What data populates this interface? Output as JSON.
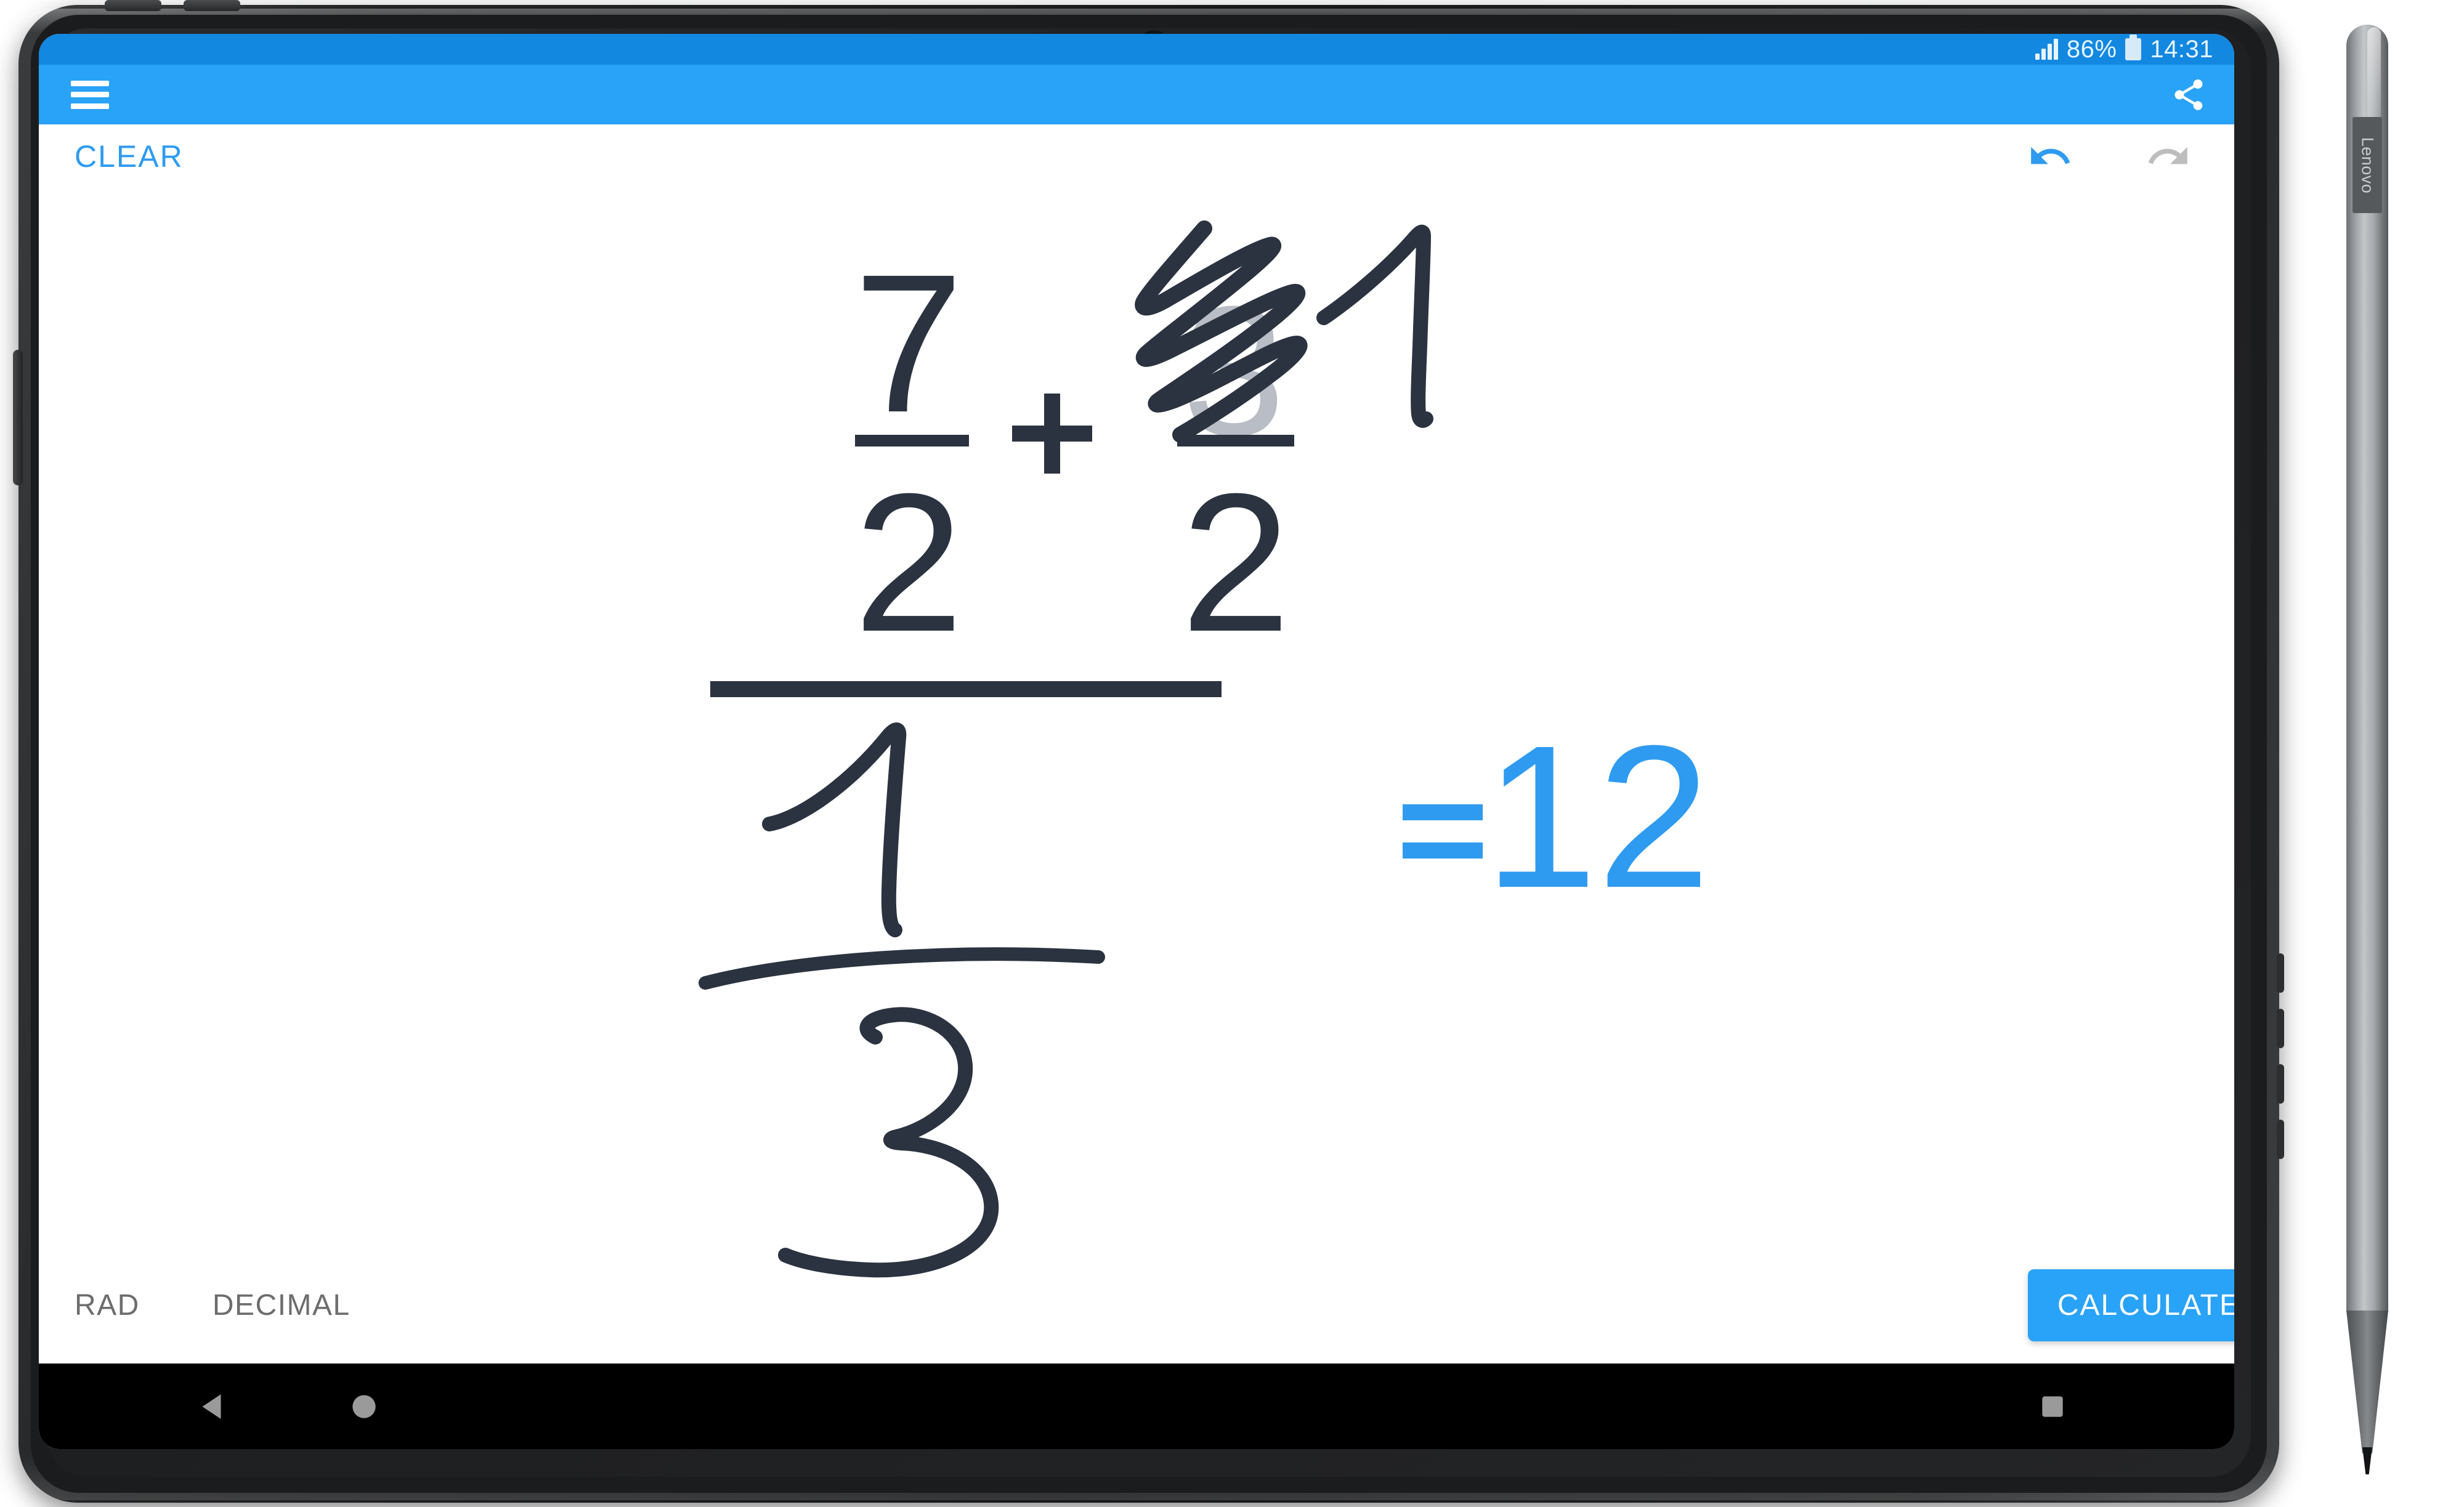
{
  "device": {
    "brand": "Lenovo",
    "stylus_label": "Lenovo"
  },
  "statusbar": {
    "battery_percent": "86%",
    "time": "14:31",
    "signal_icon": "signal-bars-icon",
    "battery_icon": "battery-icon",
    "background_color": "#1288e0"
  },
  "appbar": {
    "menu_icon": "hamburger-menu-icon",
    "share_icon": "share-icon",
    "background_color": "#29a3f7"
  },
  "actions": {
    "clear_label": "CLEAR",
    "clear_color": "#2f9bf0",
    "undo_icon": "undo-arrow-icon",
    "undo_color": "#2f9bf0",
    "undo_enabled": "true",
    "redo_icon": "redo-arrow-icon",
    "redo_color": "#bdbdbd",
    "redo_enabled": "false"
  },
  "canvas": {
    "ink_color": "#2b3240",
    "faded_ink_color": "#b9bdc6",
    "result_color": "#2f9bf0",
    "expression_text": "(7/2 + 1/2) / (1/3)",
    "numerator_left": "7",
    "numerator_left_denominator": "2",
    "operator": "+",
    "numerator_right_struck": "3",
    "numerator_right_new": "1",
    "numerator_right_denominator": "2",
    "main_denominator_numerator": "1",
    "main_denominator_denominator": "3",
    "equals_sign": "=",
    "result_value": "12",
    "scribble_note": "handwritten scratch-out over the digit 3 replacing it with 1"
  },
  "bottombar": {
    "angle_mode_label": "RAD",
    "number_mode_label": "DECIMAL",
    "mode_color": "#6d6d6d",
    "calculate_label": "CALCULATE",
    "calculate_color": "#29a3f7"
  },
  "navbar": {
    "back_icon": "back-triangle-icon",
    "home_icon": "home-circle-icon",
    "recents_icon": "recents-square-icon",
    "icon_color": "#9a9a9a",
    "background_color": "#000000"
  }
}
